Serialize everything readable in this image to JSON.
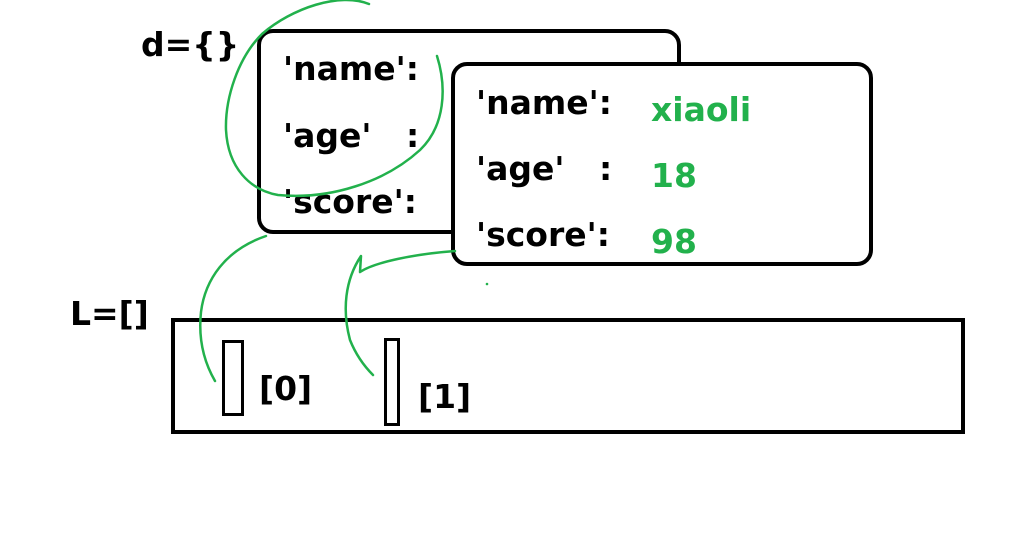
{
  "dict_label": "d={}",
  "list_label": "L=[]",
  "back_dict": {
    "keys": [
      "'name':",
      "'age'   :",
      "'score':"
    ]
  },
  "front_dict": {
    "keys": [
      "'name':",
      "'age'   :",
      "'score':"
    ],
    "values": [
      "xiaoli",
      "18",
      "98"
    ]
  },
  "list": {
    "indices": [
      "[0]",
      "[1]"
    ]
  },
  "colors": {
    "ink": "#000000",
    "value": "#22b14c",
    "arrow": "#22b14c"
  }
}
